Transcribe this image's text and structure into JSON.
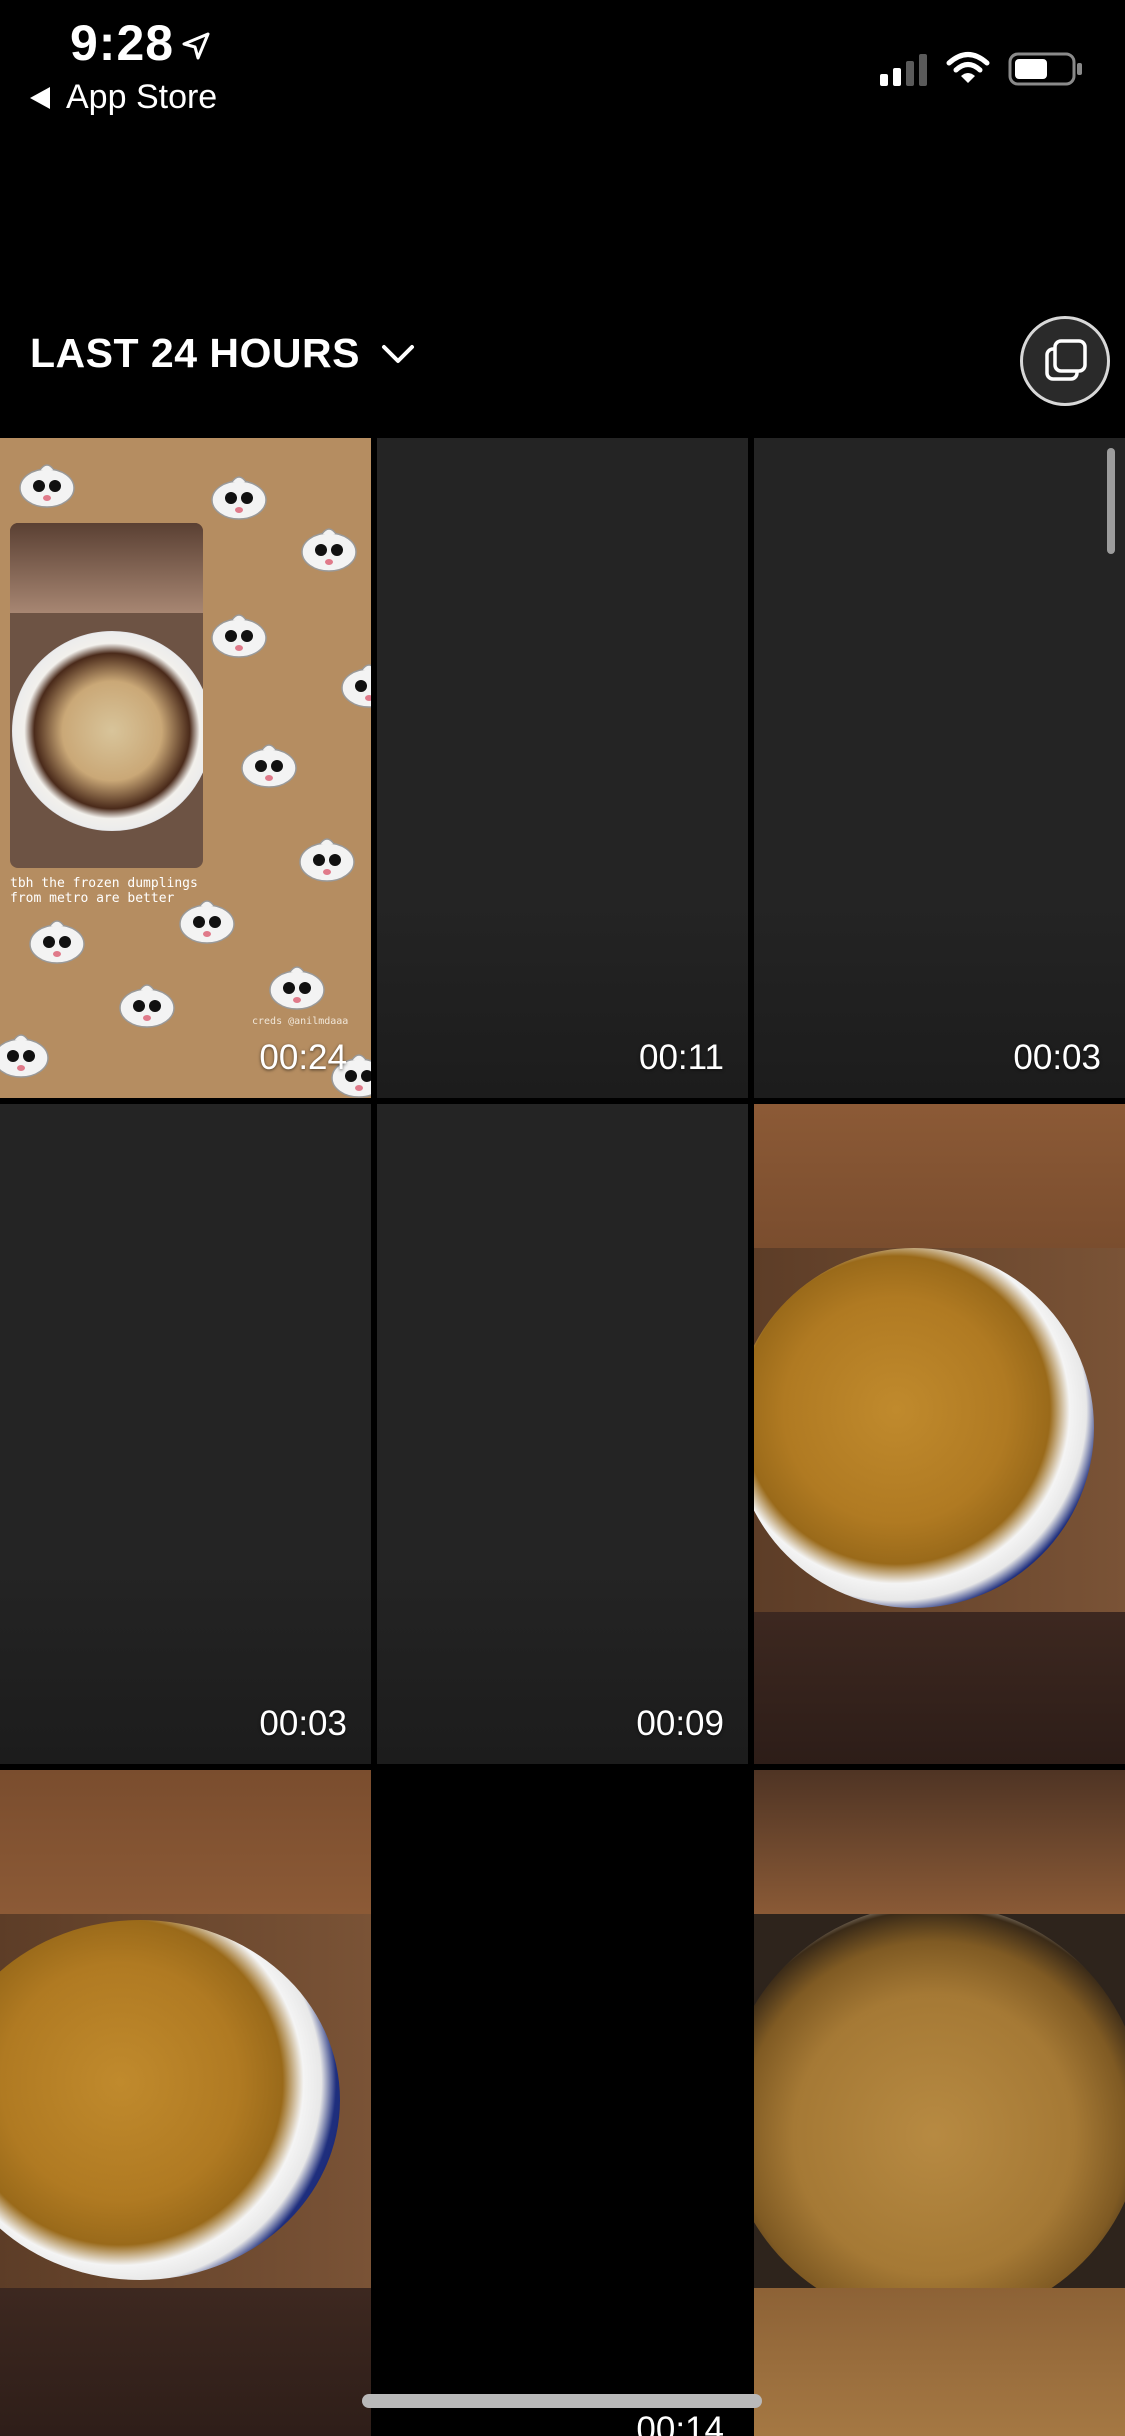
{
  "status_bar": {
    "time": "9:28",
    "back_label": "App Store",
    "icons": [
      "location-arrow-icon",
      "cellular-signal-icon",
      "wifi-icon",
      "battery-icon"
    ]
  },
  "header": {
    "title": "LAST 24 HOURS",
    "dropdown_icon": "chevron-down-icon",
    "multi_select_icon": "multi-select-icon"
  },
  "grid": {
    "tiles": [
      {
        "kind": "video",
        "thumbnail": "dumpling-story",
        "duration": "00:24",
        "caption": "tbh the frozen dumplings\nfrom metro are better",
        "credit": "creds @anilmdaaa"
      },
      {
        "kind": "video",
        "thumbnail": "dark",
        "duration": "00:11"
      },
      {
        "kind": "video",
        "thumbnail": "dark",
        "duration": "00:03"
      },
      {
        "kind": "video",
        "thumbnail": "dark",
        "duration": "00:03"
      },
      {
        "kind": "video",
        "thumbnail": "dark",
        "duration": "00:09"
      },
      {
        "kind": "photo",
        "thumbnail": "curry-bowl"
      },
      {
        "kind": "photo",
        "thumbnail": "curry-bowl"
      },
      {
        "kind": "video",
        "thumbnail": "black",
        "duration": "00:14"
      },
      {
        "kind": "photo",
        "thumbnail": "curry-pot"
      }
    ]
  },
  "colors": {
    "background": "#000000",
    "tile_dark": "#242424",
    "story_background": "#b58d61",
    "curry_bowl_blue": "#1f2f7e"
  }
}
